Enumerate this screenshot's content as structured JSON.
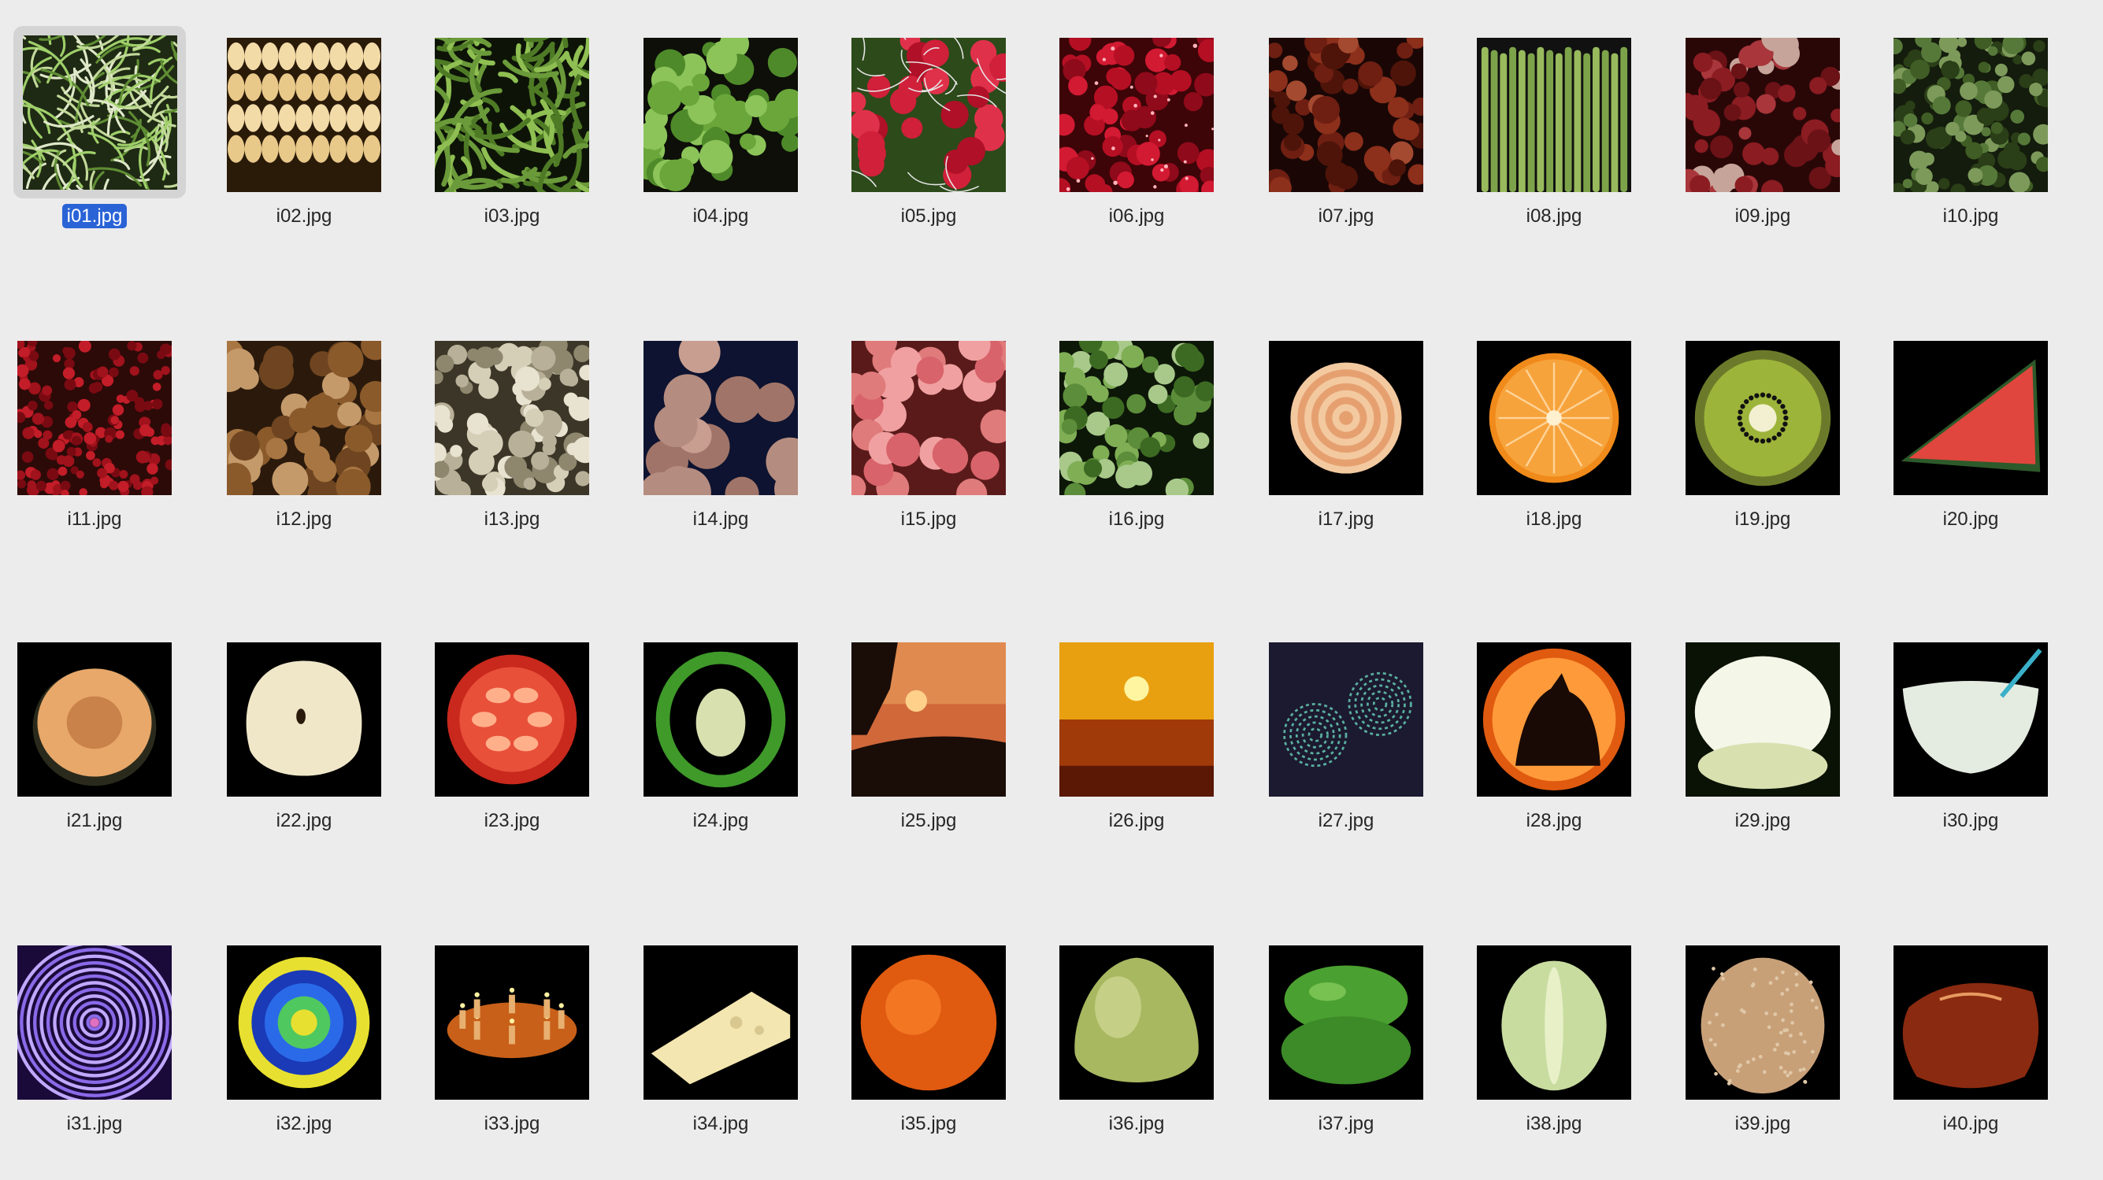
{
  "selected_index": 0,
  "files": [
    {
      "name": "i01.jpg",
      "icon": "sprouts-image-icon"
    },
    {
      "name": "i02.jpg",
      "icon": "corn-image-icon"
    },
    {
      "name": "i03.jpg",
      "icon": "green-beans-image-icon"
    },
    {
      "name": "i04.jpg",
      "icon": "snow-peas-image-icon"
    },
    {
      "name": "i05.jpg",
      "icon": "radishes-image-icon"
    },
    {
      "name": "i06.jpg",
      "icon": "cranberries-image-icon"
    },
    {
      "name": "i07.jpg",
      "icon": "dates-image-icon"
    },
    {
      "name": "i08.jpg",
      "icon": "asparagus-image-icon"
    },
    {
      "name": "i09.jpg",
      "icon": "red-onions-image-icon"
    },
    {
      "name": "i10.jpg",
      "icon": "broccoli-image-icon"
    },
    {
      "name": "i11.jpg",
      "icon": "cherries-image-icon"
    },
    {
      "name": "i12.jpg",
      "icon": "shallots-image-icon"
    },
    {
      "name": "i13.jpg",
      "icon": "ginger-image-icon"
    },
    {
      "name": "i14.jpg",
      "icon": "potatoes-image-icon"
    },
    {
      "name": "i15.jpg",
      "icon": "peaches-image-icon"
    },
    {
      "name": "i16.jpg",
      "icon": "limes-image-icon"
    },
    {
      "name": "i17.jpg",
      "icon": "onion-slice-image-icon"
    },
    {
      "name": "i18.jpg",
      "icon": "orange-half-image-icon"
    },
    {
      "name": "i19.jpg",
      "icon": "kiwi-half-image-icon"
    },
    {
      "name": "i20.jpg",
      "icon": "watermelon-slice-image-icon"
    },
    {
      "name": "i21.jpg",
      "icon": "cantaloupe-half-image-icon"
    },
    {
      "name": "i22.jpg",
      "icon": "apple-half-image-icon"
    },
    {
      "name": "i23.jpg",
      "icon": "tomato-slice-image-icon"
    },
    {
      "name": "i24.jpg",
      "icon": "pepper-slice-image-icon"
    },
    {
      "name": "i25.jpg",
      "icon": "sunset-trees-image-icon"
    },
    {
      "name": "i26.jpg",
      "icon": "sunset-sky-image-icon"
    },
    {
      "name": "i27.jpg",
      "icon": "spiral-pattern-image-icon"
    },
    {
      "name": "i28.jpg",
      "icon": "cat-pumpkin-image-icon"
    },
    {
      "name": "i29.jpg",
      "icon": "milk-glass-image-icon"
    },
    {
      "name": "i30.jpg",
      "icon": "milk-bowl-image-icon"
    },
    {
      "name": "i31.jpg",
      "icon": "purple-swirl-image-icon"
    },
    {
      "name": "i32.jpg",
      "icon": "mandala-image-icon"
    },
    {
      "name": "i33.jpg",
      "icon": "candle-ring-image-icon"
    },
    {
      "name": "i34.jpg",
      "icon": "cheese-image-icon"
    },
    {
      "name": "i35.jpg",
      "icon": "orange-image-icon"
    },
    {
      "name": "i36.jpg",
      "icon": "pear-image-icon"
    },
    {
      "name": "i37.jpg",
      "icon": "green-pepper-image-icon"
    },
    {
      "name": "i38.jpg",
      "icon": "cabbage-image-icon"
    },
    {
      "name": "i39.jpg",
      "icon": "melon-image-icon"
    },
    {
      "name": "i40.jpg",
      "icon": "roasted-meat-image-icon"
    }
  ]
}
